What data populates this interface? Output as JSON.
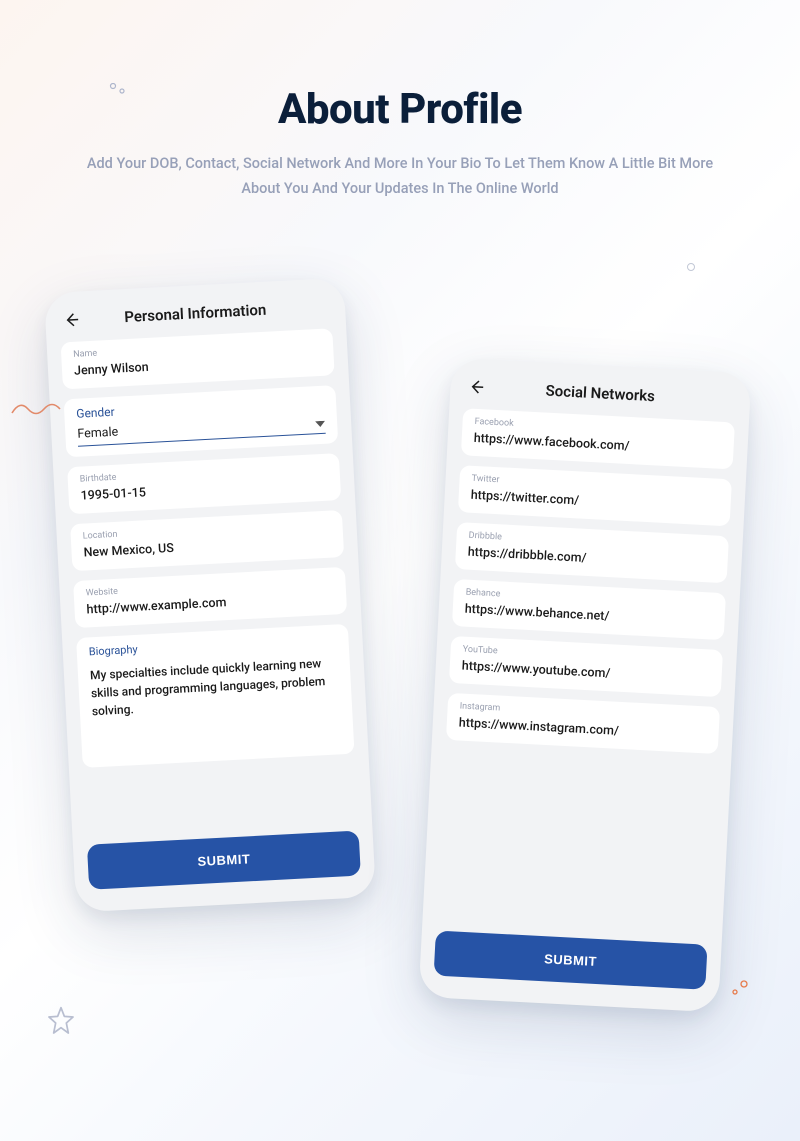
{
  "header": {
    "title": "About Profile",
    "subtitle": "Add Your DOB, Contact, Social Network And More In Your Bio To Let Them Know A Little Bit More About You And Your Updates In The Online World"
  },
  "personal": {
    "screenTitle": "Personal Information",
    "name": {
      "label": "Name",
      "value": "Jenny Wilson"
    },
    "gender": {
      "label": "Gender",
      "value": "Female"
    },
    "birthdate": {
      "label": "Birthdate",
      "value": "1995-01-15"
    },
    "location": {
      "label": "Location",
      "value": "New Mexico, US"
    },
    "website": {
      "label": "Website",
      "value": "http://www.example.com"
    },
    "biography": {
      "label": "Biography",
      "value": "My specialties include quickly learning new skills and programming languages, problem solving."
    },
    "submit": "SUBMIT"
  },
  "social": {
    "screenTitle": "Social Networks",
    "facebook": {
      "label": "Facebook",
      "value": "https://www.facebook.com/"
    },
    "twitter": {
      "label": "Twitter",
      "value": "https://twitter.com/"
    },
    "dribbble": {
      "label": "Dribbble",
      "value": "https://dribbble.com/"
    },
    "behance": {
      "label": "Behance",
      "value": "https://www.behance.net/"
    },
    "youtube": {
      "label": "YouTube",
      "value": "https://www.youtube.com/"
    },
    "instagram": {
      "label": "Instagram",
      "value": "https://www.instagram.com/"
    },
    "submit": "SUBMIT"
  }
}
